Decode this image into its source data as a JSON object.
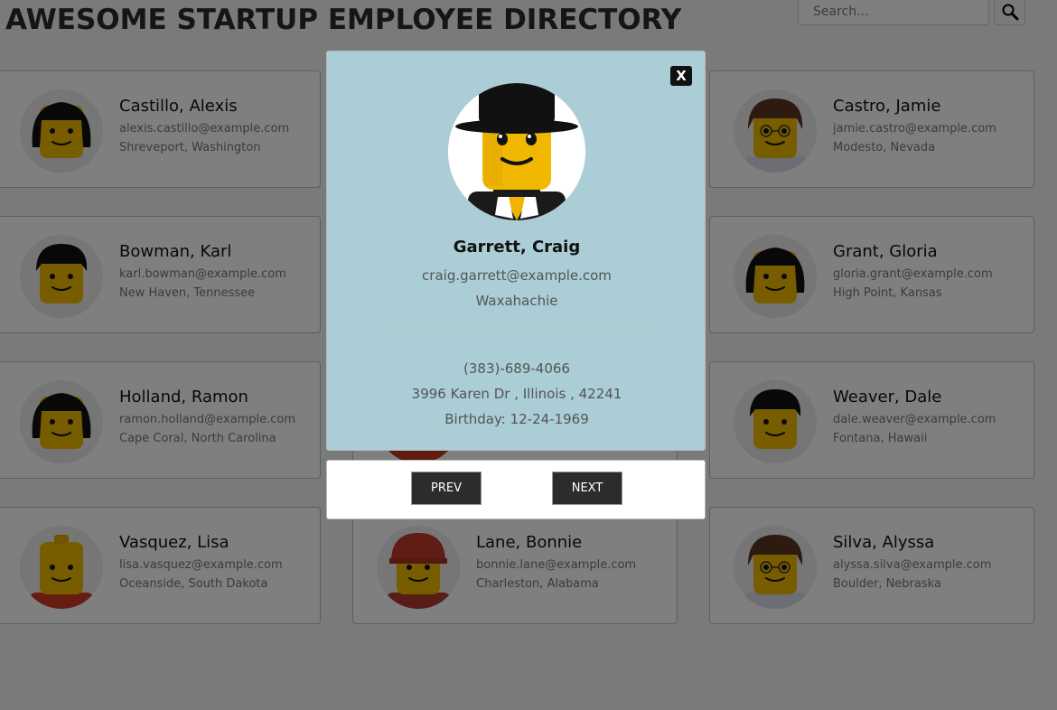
{
  "header": {
    "title": "AWESOME STARTUP EMPLOYEE DIRECTORY",
    "search_placeholder": "Search..."
  },
  "colors": {
    "overlay": "rgba(0,0,0,0.5)",
    "modal_bg": "#abcdd6",
    "button_bg": "#2c2c2c"
  },
  "employees": [
    {
      "name": "Castillo, Alexis",
      "email": "alexis.castillo@example.com",
      "location": "Shreveport, Washington",
      "avatar": "lego-long-black-hair"
    },
    {
      "name": "",
      "email": "",
      "location": "",
      "avatar": "lego-hidden"
    },
    {
      "name": "Castro, Jamie",
      "email": "jamie.castro@example.com",
      "location": "Modesto, Nevada",
      "avatar": "lego-brown-hair-glasses"
    },
    {
      "name": "Bowman, Karl",
      "email": "karl.bowman@example.com",
      "location": "New Haven, Tennessee",
      "avatar": "lego-black-hair"
    },
    {
      "name": "",
      "email": "",
      "location": "",
      "avatar": "lego-hidden"
    },
    {
      "name": "Grant, Gloria",
      "email": "gloria.grant@example.com",
      "location": "High Point, Kansas",
      "avatar": "lego-long-black-hair"
    },
    {
      "name": "Holland, Ramon",
      "email": "ramon.holland@example.com",
      "location": "Cape Coral, North Carolina",
      "avatar": "lego-long-black-hair"
    },
    {
      "name": "",
      "email": "",
      "location": "",
      "avatar": "lego-red-shirt"
    },
    {
      "name": "Weaver, Dale",
      "email": "dale.weaver@example.com",
      "location": "Fontana, Hawaii",
      "avatar": "lego-black-hair"
    },
    {
      "name": "Vasquez, Lisa",
      "email": "lisa.vasquez@example.com",
      "location": "Oceanside, South Dakota",
      "avatar": "lego-bald-red-shirt"
    },
    {
      "name": "Lane, Bonnie",
      "email": "bonnie.lane@example.com",
      "location": "Charleston, Alabama",
      "avatar": "lego-red-helmet"
    },
    {
      "name": "Silva, Alyssa",
      "email": "alyssa.silva@example.com",
      "location": "Boulder, Nebraska",
      "avatar": "lego-brown-hair-glasses"
    }
  ],
  "modal": {
    "close_label": "X",
    "name": "Garrett, Craig",
    "email": "craig.garrett@example.com",
    "city": "Waxahachie",
    "phone": "(383)-689-4066",
    "address": "3996 Karen Dr , Illinois , 42241",
    "birthday": "Birthday: 12-24-1969",
    "avatar": "lego-top-hat"
  },
  "nav": {
    "prev_label": "PREV",
    "next_label": "NEXT"
  }
}
